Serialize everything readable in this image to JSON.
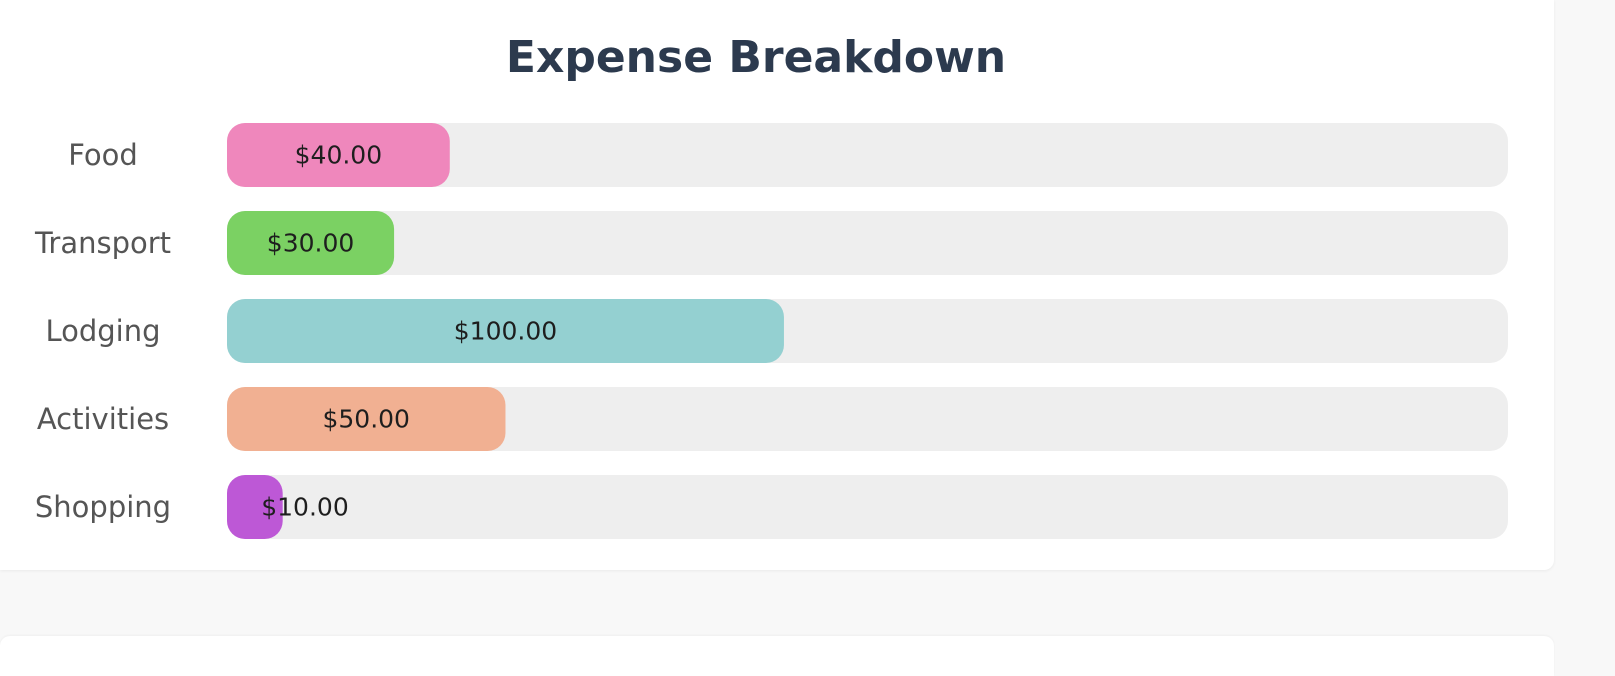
{
  "chart_data": {
    "type": "bar",
    "orientation": "horizontal",
    "title": "Expense Breakdown",
    "categories": [
      "Food",
      "Transport",
      "Lodging",
      "Activities",
      "Shopping"
    ],
    "values": [
      40,
      30,
      100,
      50,
      10
    ],
    "value_labels": [
      "$40.00",
      "$30.00",
      "$100.00",
      "$50.00",
      "$10.00"
    ],
    "colors": [
      "#ef87bc",
      "#7bd163",
      "#94d0d1",
      "#f1b092",
      "#bd58d6"
    ],
    "track_color": "#eeeeee",
    "xlim": [
      0,
      230
    ],
    "grid": false,
    "legend": "none"
  }
}
